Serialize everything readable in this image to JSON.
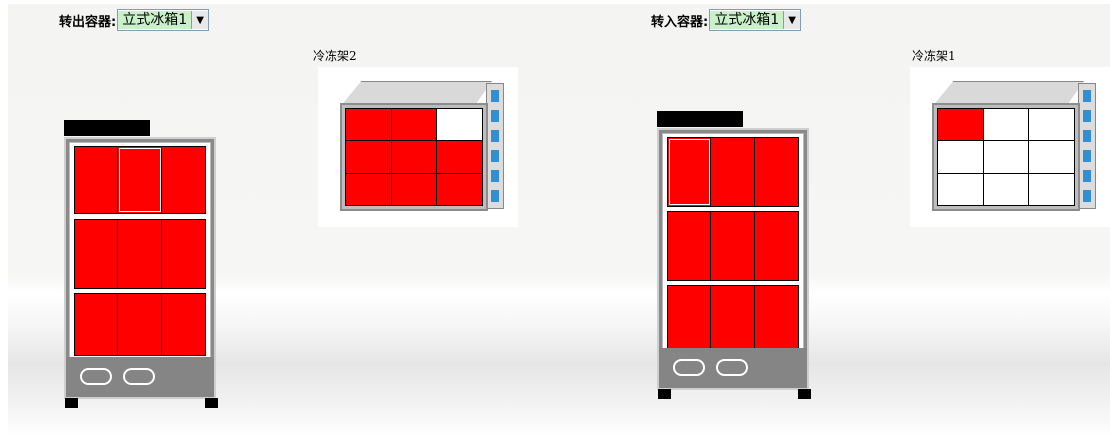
{
  "source": {
    "label": "转出容器:",
    "selected": "立式冰箱1",
    "rack_label": "冷冻架2",
    "fridge_shelves": [
      [
        "full",
        "full-highlight",
        "full"
      ],
      [
        "full",
        "full",
        "full"
      ],
      [
        "full",
        "full",
        "full"
      ]
    ],
    "rack_cells": [
      [
        "full",
        "full",
        "empty"
      ],
      [
        "full",
        "full",
        "full"
      ],
      [
        "full",
        "full",
        "full"
      ]
    ]
  },
  "target": {
    "label": "转入容器:",
    "selected": "立式冰箱1",
    "rack_label": "冷冻架1",
    "fridge_shelves": [
      [
        "full-highlight",
        "full",
        "full"
      ],
      [
        "full",
        "full",
        "full"
      ],
      [
        "full",
        "full",
        "full"
      ]
    ],
    "rack_cells": [
      [
        "full",
        "empty",
        "empty"
      ],
      [
        "empty",
        "empty",
        "empty"
      ],
      [
        "empty",
        "empty",
        "empty"
      ]
    ]
  },
  "icons": {
    "dropdown": "chevron-down-icon"
  },
  "colors": {
    "occupied": "#ff0000",
    "empty": "#ffffff",
    "select_highlight": "#c9f0c9",
    "rack_stripe": "#2f8fd0"
  }
}
